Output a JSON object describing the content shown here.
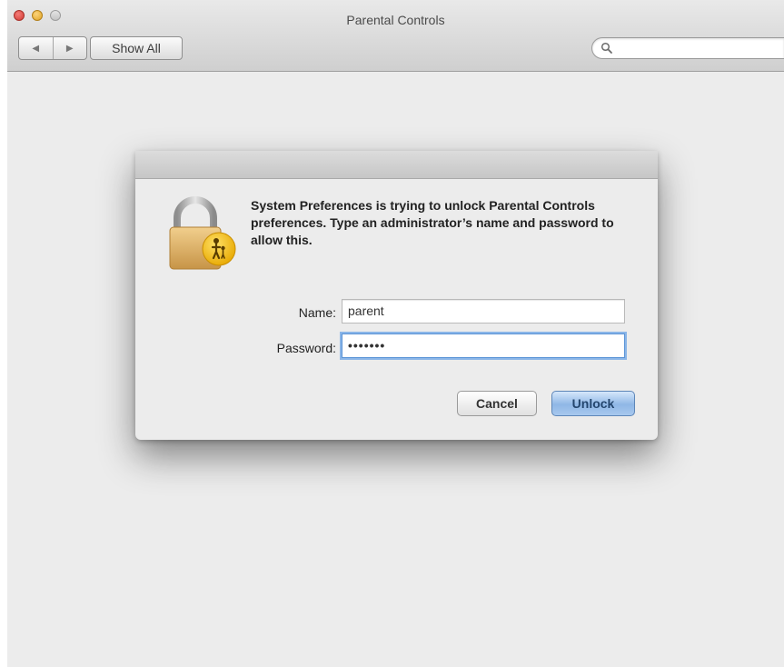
{
  "window": {
    "title": "Parental Controls",
    "toolbar": {
      "back_icon": "back-arrow-icon",
      "forward_icon": "forward-arrow-icon",
      "back_glyph": "◀",
      "forward_glyph": "▶",
      "show_all_label": "Show All",
      "search_placeholder": ""
    }
  },
  "dialog": {
    "message": "System Preferences is trying to unlock Parental Controls preferences. Type an administrator’s name and password to allow this.",
    "name_label": "Name:",
    "name_value": "parent",
    "password_label": "Password:",
    "password_value": "•••••••",
    "cancel_label": "Cancel",
    "unlock_label": "Unlock"
  },
  "colors": {
    "unlock_accent": "#8fb7e6",
    "focus_ring": "#8bb6e8",
    "close_button": "#d23a33",
    "minimize_button": "#e1a422",
    "lock_badge": "#f5b800"
  }
}
